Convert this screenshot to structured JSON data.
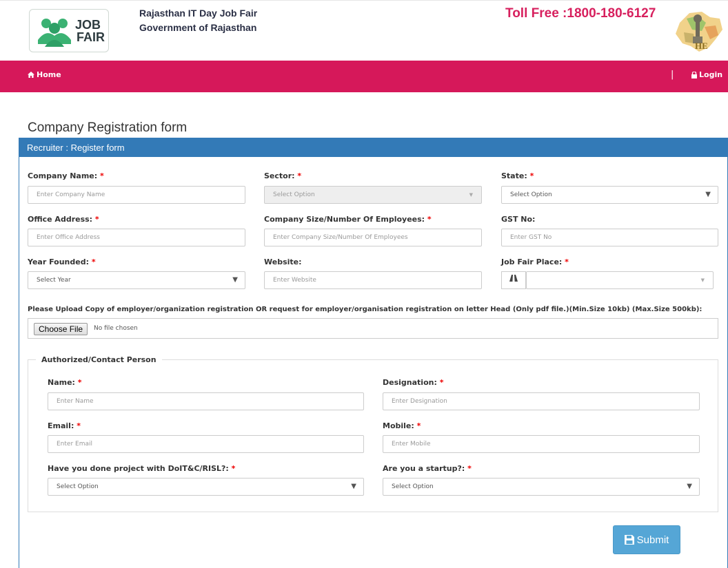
{
  "header": {
    "logo_line1": "JOB",
    "logo_line2": "FAIR",
    "title_line1": "Rajasthan IT Day Job Fair",
    "title_line2": "Government of Rajasthan",
    "tollfree": "Toll Free :1800-180-6127"
  },
  "nav": {
    "home": "Home",
    "separator": "|",
    "login": "Login"
  },
  "page_title": "Company Registration form",
  "panel_title": "Recruiter : Register form",
  "fields": {
    "company_name": {
      "label": "Company Name:",
      "placeholder": "Enter Company Name"
    },
    "sector": {
      "label": "Sector:",
      "value": "Select Option"
    },
    "state": {
      "label": "State:",
      "value": "Select Option"
    },
    "office_address": {
      "label": "Office Address:",
      "placeholder": "Enter Office Address"
    },
    "company_size": {
      "label": "Company Size/Number Of Employees:",
      "placeholder": "Enter Company Size/Number Of Employees"
    },
    "gst": {
      "label": "GST No:",
      "placeholder": "Enter GST No"
    },
    "year_founded": {
      "label": "Year Founded:",
      "value": "Select Year"
    },
    "website": {
      "label": "Website:",
      "placeholder": "Enter Website"
    },
    "job_fair_place": {
      "label": "Job Fair Place:",
      "value": ""
    }
  },
  "upload": {
    "label": "Please Upload Copy of employer/organization registration OR request for employer/organisation registration on letter Head (Only pdf file.)(Min.Size 10kb) (Max.Size 500kb):",
    "button": "Choose File",
    "status": "No file chosen"
  },
  "contact": {
    "legend": "Authorized/Contact Person",
    "name": {
      "label": "Name:",
      "placeholder": "Enter Name"
    },
    "designation": {
      "label": "Designation:",
      "placeholder": "Enter Designation"
    },
    "email": {
      "label": "Email:",
      "placeholder": "Enter Email"
    },
    "mobile": {
      "label": "Mobile:",
      "placeholder": "Enter Mobile"
    },
    "project": {
      "label": "Have you done project with DoIT&C/RISL?:",
      "value": "Select Option"
    },
    "startup": {
      "label": "Are you a startup?:",
      "value": "Select Option"
    }
  },
  "required_mark": "*",
  "submit_label": "Submit",
  "colors": {
    "nav": "#d6185a",
    "panel": "#337ab7",
    "tollfree": "#d7205e",
    "submit": "#55a6d6",
    "logo_green": "#3bb273"
  }
}
